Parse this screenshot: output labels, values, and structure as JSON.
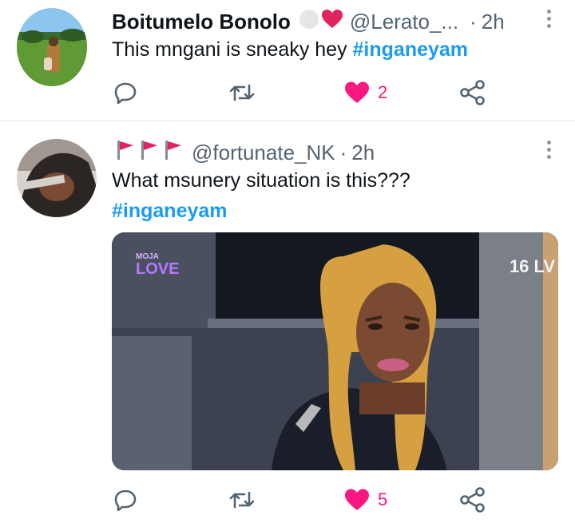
{
  "tweets": [
    {
      "display_name": "Boitumelo Bonolo",
      "handle": "@Lerato_...",
      "separator": "·",
      "time": "2h",
      "text": "This mngani is sneaky hey ",
      "hashtags": [
        "#inganeyam"
      ],
      "likes": "2",
      "liked": true
    },
    {
      "handle": "@fortunate_NK",
      "separator": "·",
      "time": "2h",
      "text": "What msunery situation is this???",
      "hashtags": [
        "#inganeyam"
      ],
      "likes": "5",
      "liked": true,
      "media": {
        "channel_logo_line1": "MOJA",
        "channel_logo_line2": "LOVE",
        "channel_number": "16 LV"
      }
    }
  ],
  "colors": {
    "accent": "#1d9bf0",
    "like": "#f91880",
    "muted": "#536471",
    "flag": "#e0245e"
  },
  "icons": [
    "reply-icon",
    "retweet-icon",
    "heart-icon",
    "share-icon",
    "more-icon",
    "flag-icon"
  ]
}
